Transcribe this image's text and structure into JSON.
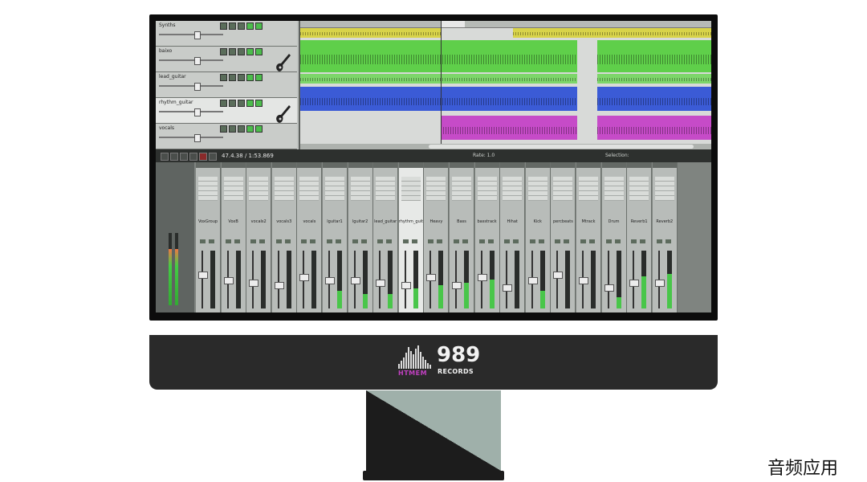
{
  "tracks": [
    {
      "name": "Synths",
      "top": 0,
      "selected": false
    },
    {
      "name": "baixo",
      "top": 0,
      "selected": false
    },
    {
      "name": "lead_guitar",
      "top": 0,
      "selected": false
    },
    {
      "name": "rhythm_guitar",
      "top": 0,
      "selected": true
    },
    {
      "name": "vocals",
      "top": 0,
      "selected": false
    }
  ],
  "transport": {
    "time": "47.4.38 / 1:53.869",
    "rate_label": "Rate: 1.0",
    "selection_label": "Selection:"
  },
  "mixer": {
    "channels": [
      {
        "name": "VoxGroup",
        "meter": 0.0,
        "fader": 0.6,
        "highlight": false
      },
      {
        "name": "VoxB",
        "meter": 0.0,
        "fader": 0.5,
        "highlight": false
      },
      {
        "name": "vocals2",
        "meter": 0.0,
        "fader": 0.45,
        "highlight": false
      },
      {
        "name": "vocals3",
        "meter": 0.0,
        "fader": 0.4,
        "highlight": false
      },
      {
        "name": "vocals",
        "meter": 0.0,
        "fader": 0.55,
        "highlight": false
      },
      {
        "name": "lguitar1",
        "meter": 0.3,
        "fader": 0.5,
        "highlight": false
      },
      {
        "name": "lguitar2",
        "meter": 0.25,
        "fader": 0.5,
        "highlight": false
      },
      {
        "name": "lead_guitar",
        "meter": 0.25,
        "fader": 0.45,
        "highlight": false
      },
      {
        "name": "rhythm_guitar",
        "meter": 0.35,
        "fader": 0.4,
        "highlight": true
      },
      {
        "name": "Heavy",
        "meter": 0.4,
        "fader": 0.55,
        "highlight": false
      },
      {
        "name": "Bass",
        "meter": 0.45,
        "fader": 0.4,
        "highlight": false
      },
      {
        "name": "basstrack",
        "meter": 0.5,
        "fader": 0.55,
        "highlight": false
      },
      {
        "name": "Hihat",
        "meter": 0.0,
        "fader": 0.35,
        "highlight": false
      },
      {
        "name": "Kick",
        "meter": 0.3,
        "fader": 0.5,
        "highlight": false
      },
      {
        "name": "percbeats",
        "meter": 0.0,
        "fader": 0.6,
        "highlight": false
      },
      {
        "name": "Mtrack",
        "meter": 0.0,
        "fader": 0.5,
        "highlight": false
      },
      {
        "name": "Drum",
        "meter": 0.2,
        "fader": 0.35,
        "highlight": false
      },
      {
        "name": "Reverb1",
        "meter": 0.55,
        "fader": 0.45,
        "highlight": false
      },
      {
        "name": "Reverb2",
        "meter": 0.6,
        "fader": 0.45,
        "highlight": false
      }
    ]
  },
  "logo": {
    "left_text": "HTMEM",
    "number": "989",
    "right_text": "RECORDS"
  },
  "caption": "音频应用",
  "colors": {
    "yellow_lane": "#d8d34a",
    "green_lane": "#5fcf4a",
    "blue_lane": "#3b5bd6",
    "purple_lane": "#c64bc8",
    "meter_green": "#49c64a"
  }
}
